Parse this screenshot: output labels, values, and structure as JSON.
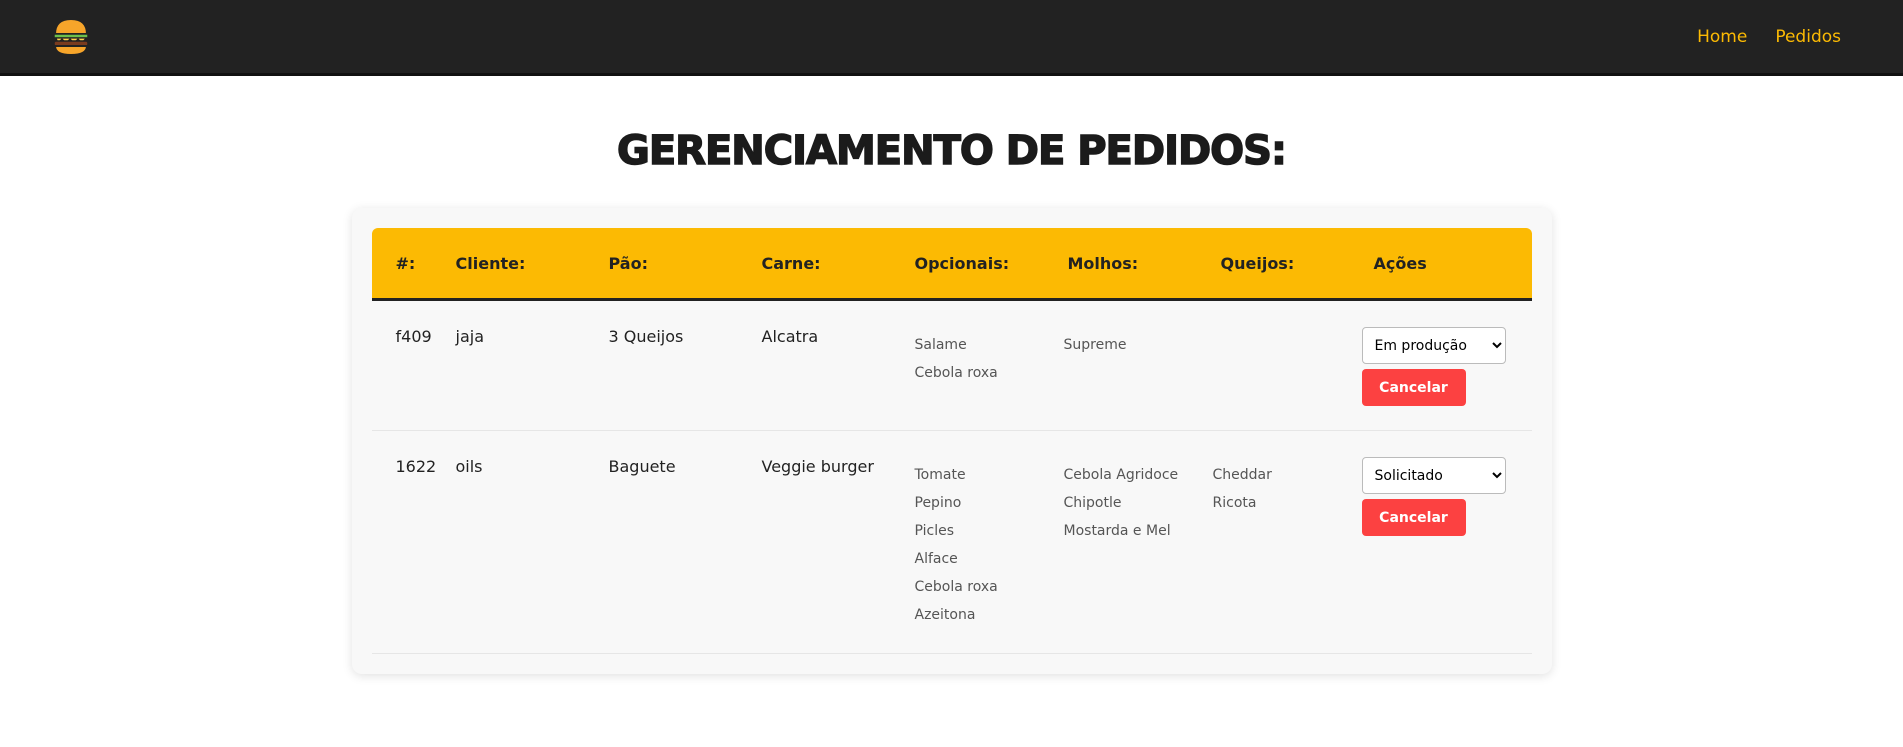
{
  "nav": {
    "home": "Home",
    "orders": "Pedidos"
  },
  "page": {
    "title": "Gerenciamento de pedidos:"
  },
  "table": {
    "headers": [
      "#:",
      "Cliente:",
      "Pão:",
      "Carne:",
      "Opcionais:",
      "Molhos:",
      "Queijos:",
      "Ações"
    ],
    "cancel_label": "Cancelar",
    "rows": [
      {
        "id": "f409",
        "client": "jaja",
        "bread": "3 Queijos",
        "meat": "Alcatra",
        "optionals": [
          "Salame",
          "Cebola roxa"
        ],
        "sauces": [
          "Supreme"
        ],
        "cheeses": [],
        "status": "Em produção"
      },
      {
        "id": "1622",
        "client": "oils",
        "bread": "Baguete",
        "meat": "Veggie burger",
        "optionals": [
          "Tomate",
          "Pepino",
          "Picles",
          "Alface",
          "Cebola roxa",
          "Azeitona"
        ],
        "sauces": [
          "Cebola Agridoce",
          "Chipotle",
          "Mostarda e Mel"
        ],
        "cheeses": [
          "Cheddar",
          "Ricota"
        ],
        "status": "Solicitado"
      }
    ]
  },
  "icons": {
    "logo": "burger-icon"
  },
  "colors": {
    "accent": "#fcba03",
    "navbar": "#222222",
    "danger": "#fc4141"
  }
}
